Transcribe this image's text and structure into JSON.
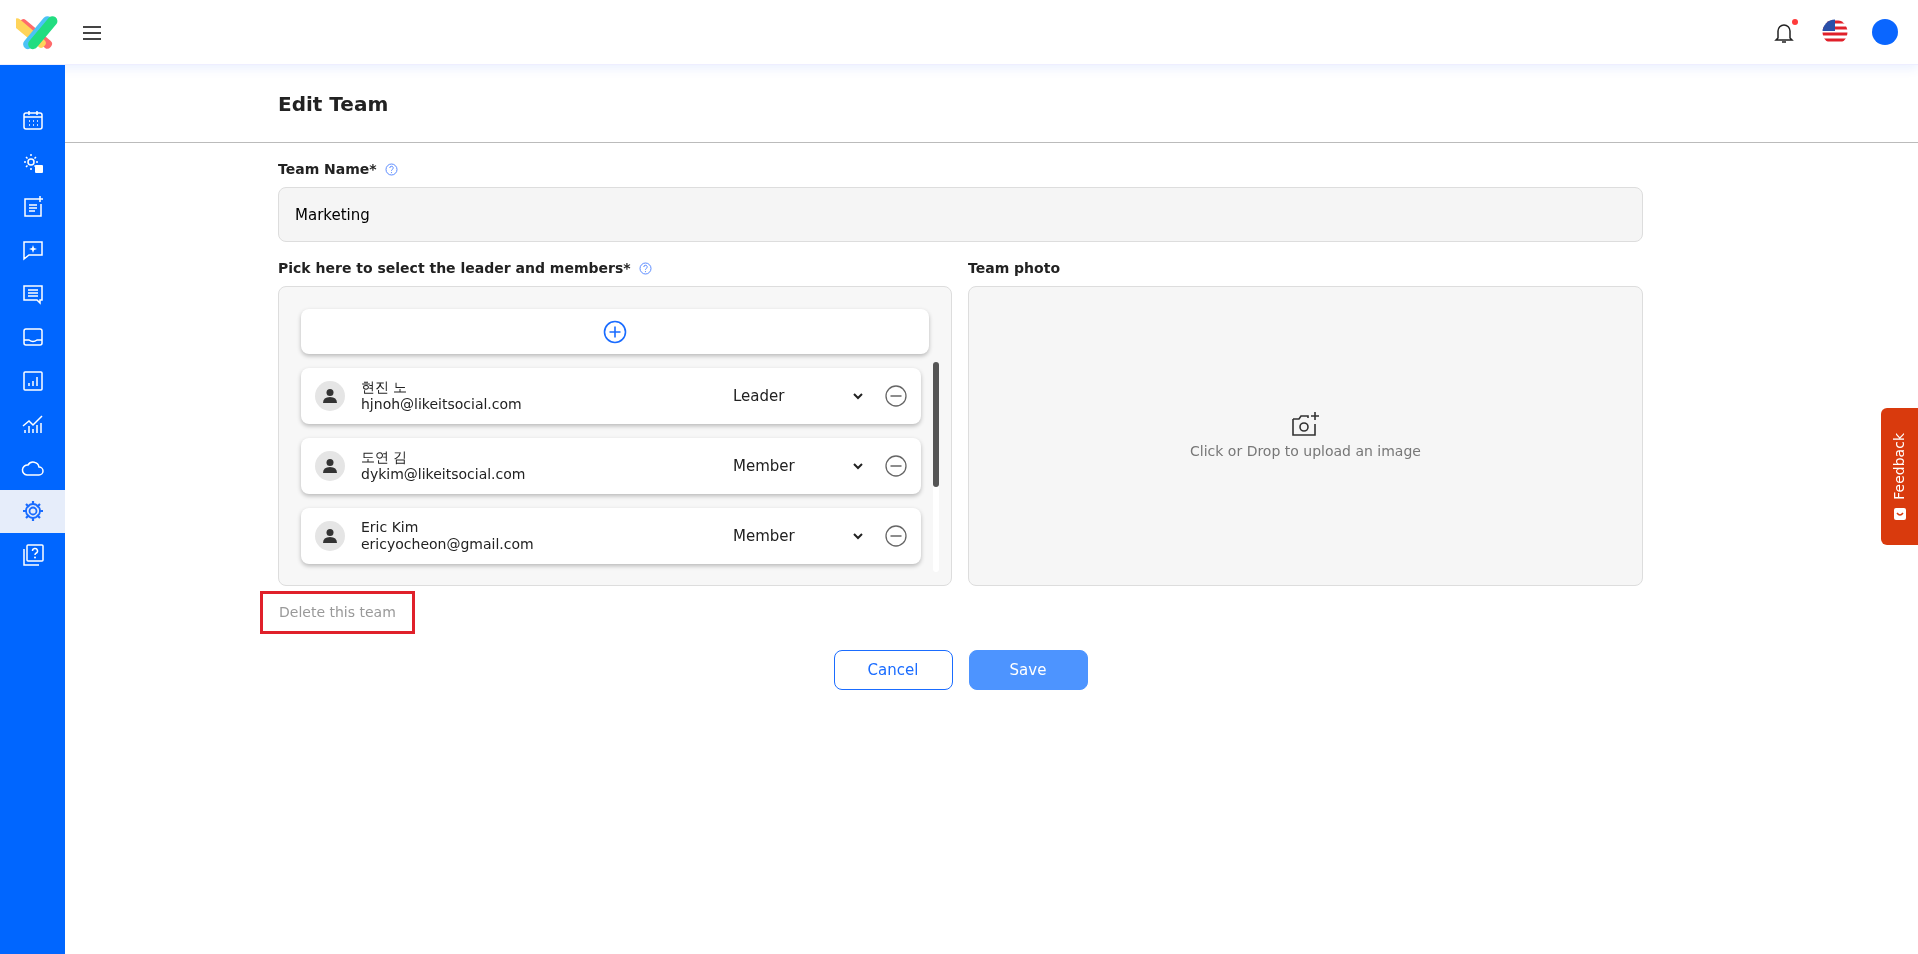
{
  "header": {
    "notifications": {
      "unread": true
    }
  },
  "sidebar": {
    "items": [
      {
        "selected": false
      },
      {
        "selected": false
      },
      {
        "selected": false
      },
      {
        "selected": false
      },
      {
        "selected": false
      },
      {
        "selected": false
      },
      {
        "selected": false
      },
      {
        "selected": false
      },
      {
        "selected": false
      },
      {
        "selected": true
      },
      {
        "selected": false
      }
    ]
  },
  "page": {
    "title": "Edit Team"
  },
  "form": {
    "team_name": {
      "label": "Team Name*",
      "value": "Marketing"
    },
    "members": {
      "label": "Pick here to select the leader and members*",
      "list": [
        {
          "name": "현진 노",
          "email": "hjnoh@likeitsocial.com",
          "role": "Leader"
        },
        {
          "name": "도연 김",
          "email": "dykim@likeitsocial.com",
          "role": "Member"
        },
        {
          "name": "Eric Kim",
          "email": "ericyocheon@gmail.com",
          "role": "Member"
        }
      ]
    },
    "team_photo": {
      "label": "Team photo",
      "hint": "Click or Drop to upload an image"
    },
    "delete_link": {
      "label": "Delete this team",
      "highlighted": true
    },
    "buttons": [
      {
        "label": "Cancel",
        "kind": "secondary"
      },
      {
        "label": "Save",
        "kind": "primary"
      }
    ]
  },
  "feedback_tab": {
    "label": "Feedback"
  }
}
